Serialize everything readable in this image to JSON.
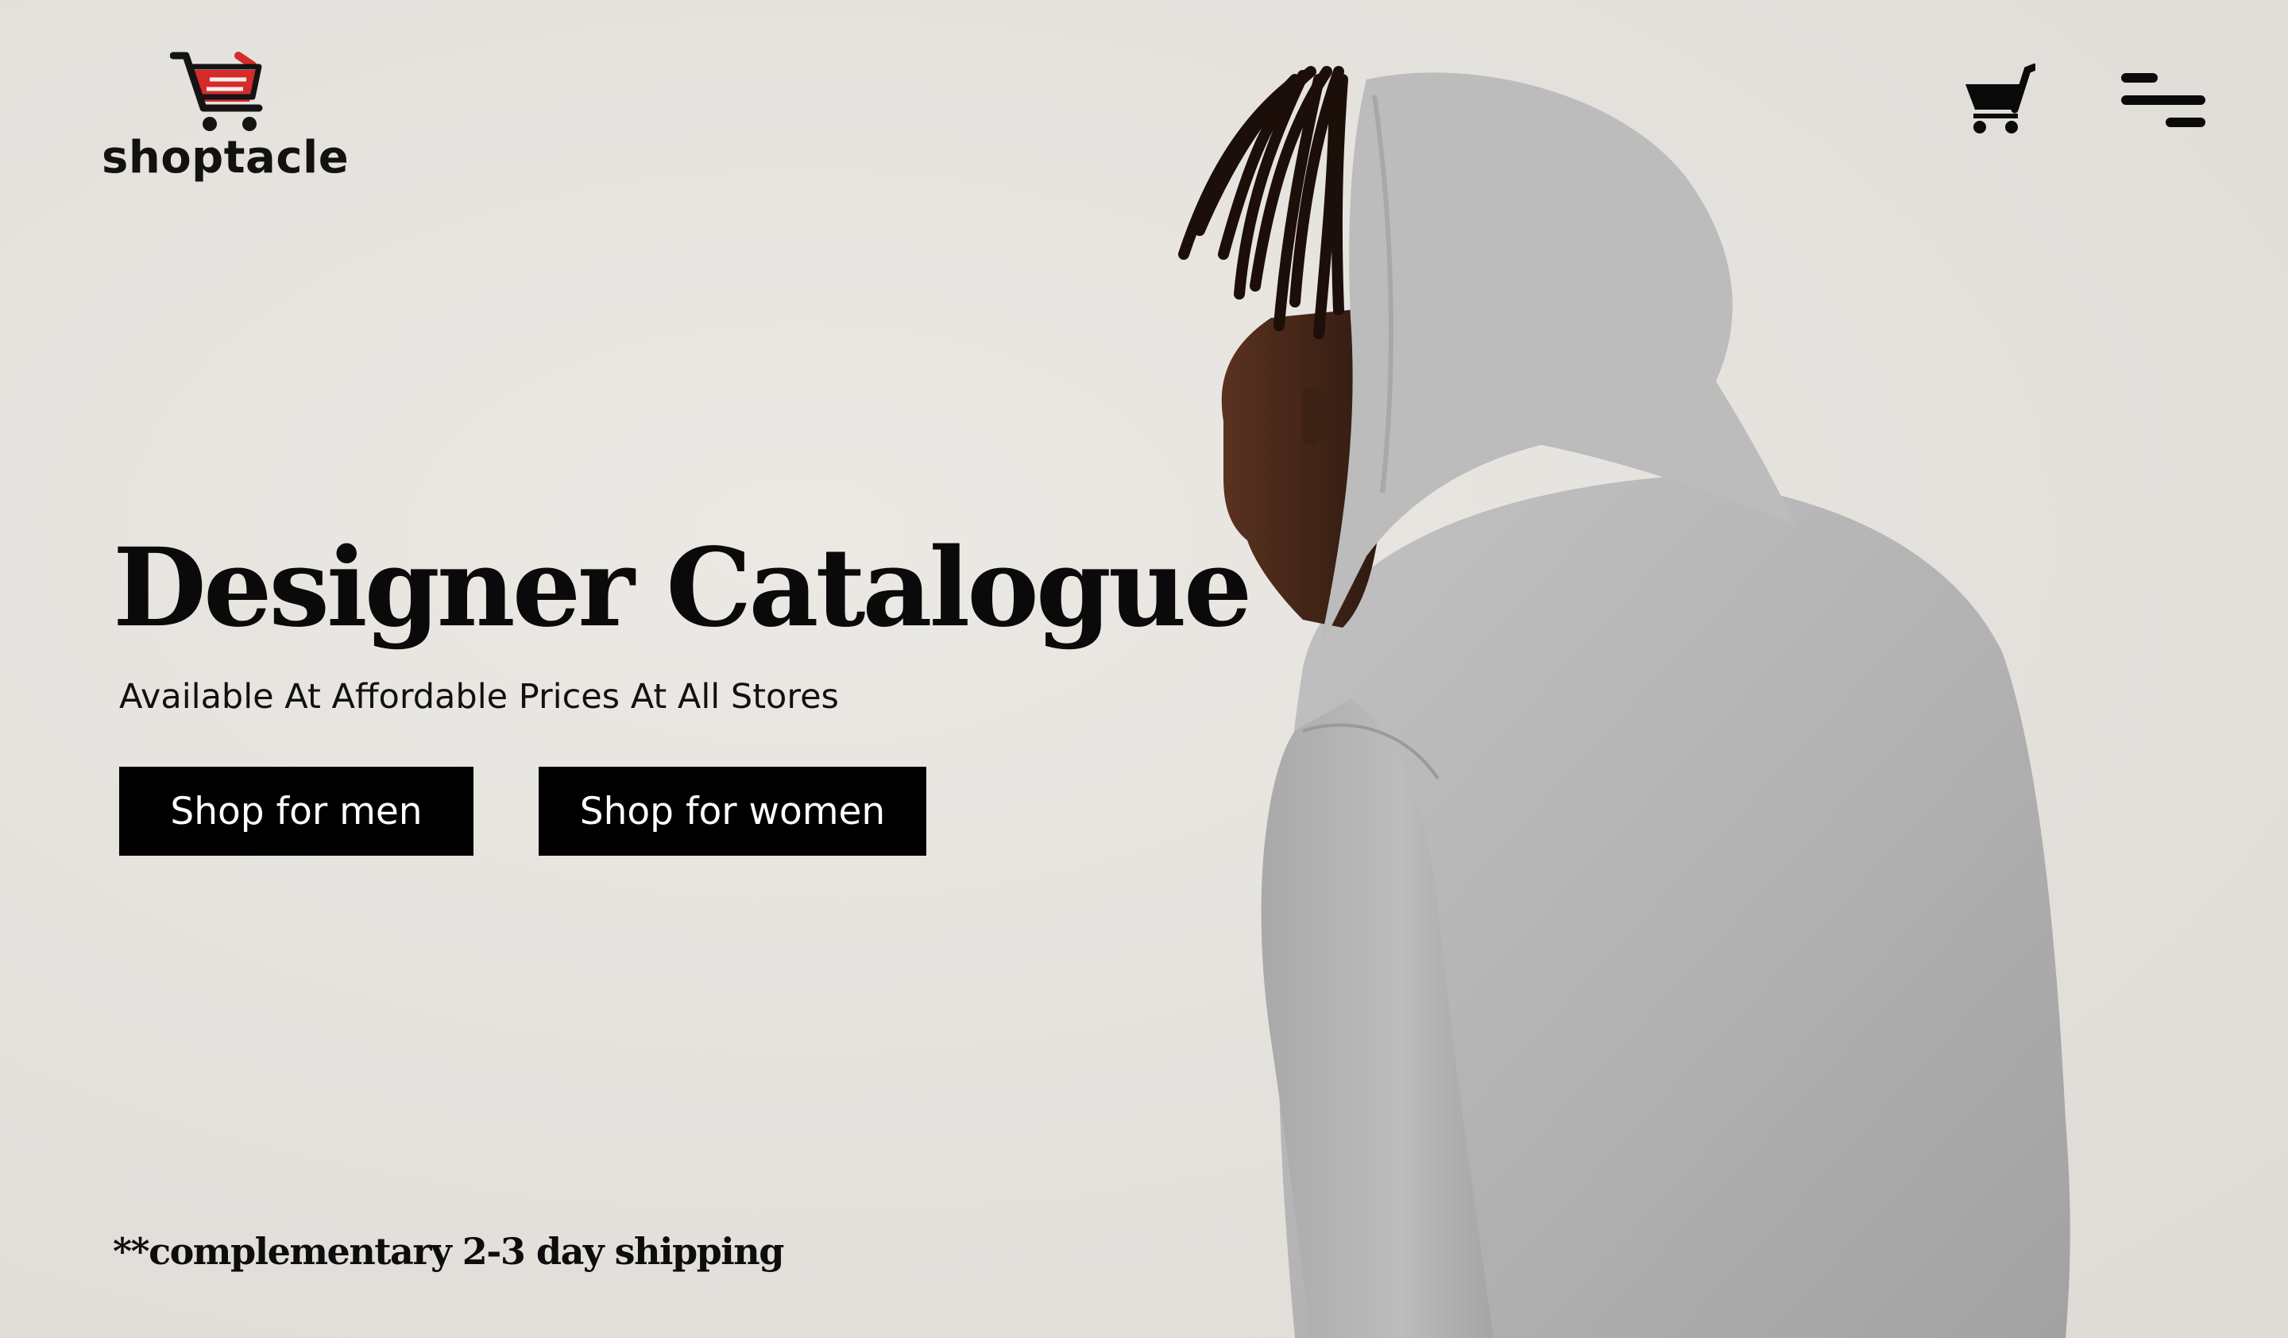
{
  "brand": {
    "name": "shoptacle",
    "logo_icon": "shopping-cart-logo-icon",
    "accent": "#d62b2b",
    "ink": "#141414"
  },
  "header": {
    "cart_icon": "shopping-cart-icon",
    "menu_icon": "hamburger-menu-icon"
  },
  "hero": {
    "title": "Designer Catalogue",
    "subtitle": "Available At Affordable Prices At All Stores",
    "buttons": {
      "men_label": "Shop for men",
      "women_label": "Shop for women"
    },
    "shipping_note": "**complementary 2-3 day shipping",
    "image": "model-in-grey-hoodie-image"
  },
  "colors": {
    "background": "#e6e3df",
    "button_bg": "#000000",
    "button_text": "#ffffff",
    "hoodie": "#b4b4b4"
  }
}
